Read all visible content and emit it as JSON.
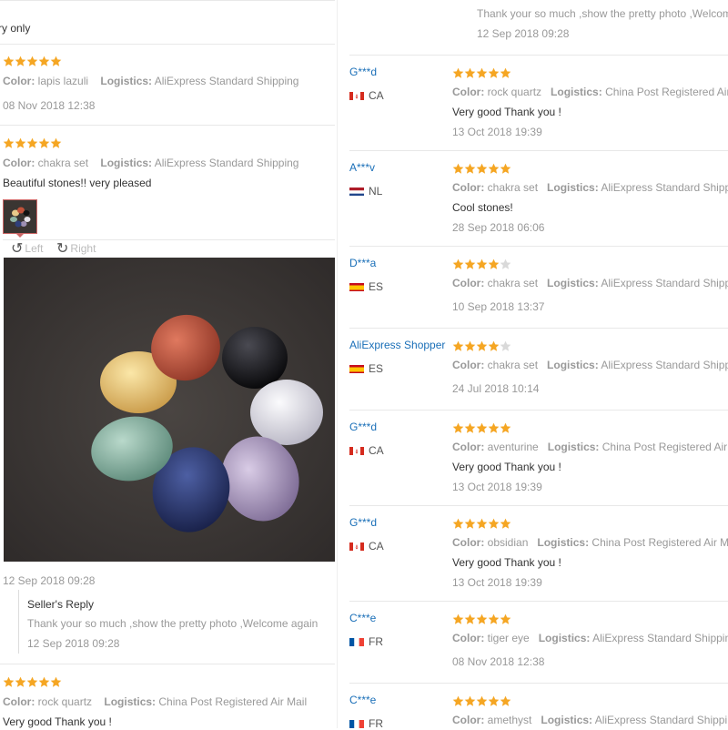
{
  "left": {
    "top_text": "ry only",
    "review1": {
      "color_label": "Color:",
      "color": "lapis lazuli",
      "logistics_label": "Logistics:",
      "logistics": "AliExpress Standard Shipping",
      "date": "08 Nov 2018 12:38",
      "stars": 5
    },
    "review2": {
      "color_label": "Color:",
      "color": "chakra set",
      "logistics_label": "Logistics:",
      "logistics": "AliExpress Standard Shipping",
      "comment": "Beautiful stones!! very pleased",
      "stars": 5,
      "rotate_left": "Left",
      "rotate_right": "Right",
      "date": "12 Sep 2018 09:28",
      "seller_reply_title": "Seller's Reply",
      "seller_reply_text": "Thank your so much ,show the pretty photo ,Welcome again",
      "seller_reply_date": "12 Sep 2018 09:28"
    },
    "review3": {
      "color_label": "Color:",
      "color": "rock quartz",
      "logistics_label": "Logistics:",
      "logistics": "China Post Registered Air Mail",
      "comment": "Very good Thank you !",
      "stars": 5
    }
  },
  "right": {
    "top_reply_text": "Thank your so much ,show the pretty photo ,Welcome a",
    "top_reply_date": "12 Sep 2018 09:28",
    "reviews": [
      {
        "user": "G***d",
        "country": "CA",
        "stars": 5,
        "color_label": "Color:",
        "color": "rock quartz",
        "logistics_label": "Logistics:",
        "logistics": "China Post Registered Air",
        "comment": "Very good Thank you !",
        "date": "13 Oct 2018 19:39"
      },
      {
        "user": "A***v",
        "country": "NL",
        "stars": 5,
        "color_label": "Color:",
        "color": "chakra set",
        "logistics_label": "Logistics:",
        "logistics": "AliExpress Standard Shipp",
        "comment": "Cool stones!",
        "date": "28 Sep 2018 06:06"
      },
      {
        "user": "D***a",
        "country": "ES",
        "stars": 4,
        "color_label": "Color:",
        "color": "chakra set",
        "logistics_label": "Logistics:",
        "logistics": "AliExpress Standard Shipp",
        "comment": "",
        "date": "10 Sep 2018 13:37"
      },
      {
        "user": "AliExpress Shopper",
        "country": "ES",
        "stars": 4,
        "color_label": "Color:",
        "color": "chakra set",
        "logistics_label": "Logistics:",
        "logistics": "AliExpress Standard Shipp",
        "comment": "",
        "date": "24 Jul 2018 10:14"
      },
      {
        "user": "G***d",
        "country": "CA",
        "stars": 5,
        "color_label": "Color:",
        "color": "aventurine",
        "logistics_label": "Logistics:",
        "logistics": "China Post Registered Air",
        "comment": "Very good Thank you !",
        "date": "13 Oct 2018 19:39"
      },
      {
        "user": "G***d",
        "country": "CA",
        "stars": 5,
        "color_label": "Color:",
        "color": "obsidian",
        "logistics_label": "Logistics:",
        "logistics": "China Post Registered Air M",
        "comment": "Very good Thank you !",
        "date": "13 Oct 2018 19:39"
      },
      {
        "user": "C***e",
        "country": "FR",
        "stars": 5,
        "color_label": "Color:",
        "color": "tiger eye",
        "logistics_label": "Logistics:",
        "logistics": "AliExpress Standard Shippin",
        "comment": "",
        "date": "08 Nov 2018 12:38"
      },
      {
        "user": "C***e",
        "country": "FR",
        "stars": 5,
        "color_label": "Color:",
        "color": "amethyst",
        "logistics_label": "Logistics:",
        "logistics": "AliExpress Standard Shippi",
        "comment": "",
        "date": ""
      }
    ]
  },
  "colors": {
    "star": "#f5a623",
    "star_empty": "#d9d9d9",
    "username": "#1a6fb8"
  }
}
